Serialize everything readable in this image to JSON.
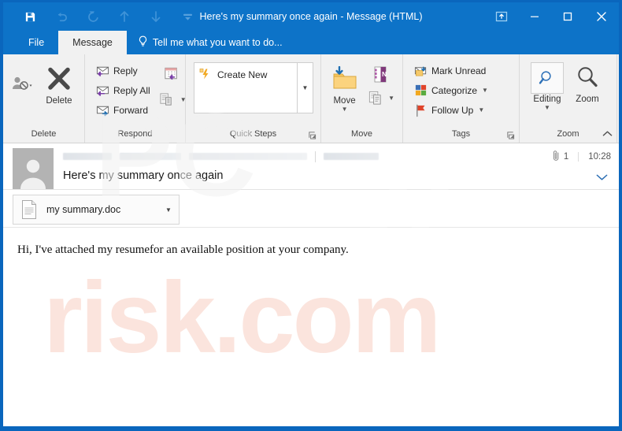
{
  "window": {
    "title": "Here's my summary once again - Message (HTML)",
    "accent_color": "#0d73c8",
    "border_color": "#0a66bd"
  },
  "quick_access_toolbar": {
    "items": [
      {
        "name": "save",
        "icon": "save-icon",
        "enabled": true
      },
      {
        "name": "undo",
        "icon": "undo-icon",
        "enabled": false
      },
      {
        "name": "redo",
        "icon": "redo-icon",
        "enabled": false
      },
      {
        "name": "previous-item",
        "icon": "arrow-up-icon",
        "enabled": false
      },
      {
        "name": "next-item",
        "icon": "arrow-down-icon",
        "enabled": false
      },
      {
        "name": "customize",
        "icon": "chevron-down-icon",
        "enabled": false
      }
    ]
  },
  "window_controls": {
    "restore_ribbon": "restore-window-icon",
    "minimize": "minimize-icon",
    "maximize": "maximize-icon",
    "close": "close-icon"
  },
  "tabs": {
    "file": "File",
    "message": "Message",
    "tell_me": "Tell me what you want to do...",
    "active": "Message"
  },
  "ribbon": {
    "groups": [
      {
        "label": "Delete",
        "buttons": [
          {
            "label": "Ignore",
            "icon": "ignore-person-icon",
            "has_caret": true
          },
          {
            "label": "Delete",
            "icon": "delete-x-icon",
            "has_caret": false
          }
        ]
      },
      {
        "label": "Respond",
        "buttons": [
          {
            "label": "Reply",
            "icon": "reply-icon"
          },
          {
            "label": "Reply All",
            "icon": "reply-all-icon"
          },
          {
            "label": "Forward",
            "icon": "forward-icon"
          },
          {
            "label": "Meeting",
            "icon": "meeting-calendar-icon"
          },
          {
            "label": "More",
            "icon": "more-respond-icon",
            "has_caret": true
          }
        ]
      },
      {
        "label": "Quick Steps",
        "gallery_items": [
          {
            "label": "Create New",
            "icon": "lightning-bolt-icon"
          }
        ],
        "more_caret": true,
        "dialog_launcher": true
      },
      {
        "label": "Move",
        "buttons": [
          {
            "label": "Move",
            "icon": "move-folder-icon",
            "has_caret": true
          },
          {
            "label": "OneNote",
            "icon": "onenote-icon"
          },
          {
            "label": "Rules",
            "icon": "rules-icon",
            "has_caret": true
          }
        ]
      },
      {
        "label": "Tags",
        "buttons": [
          {
            "label": "Mark Unread",
            "icon": "mark-unread-envelope-icon"
          },
          {
            "label": "Categorize",
            "icon": "categorize-swatch-icon",
            "has_caret": true
          },
          {
            "label": "Follow Up",
            "icon": "follow-up-flag-icon",
            "has_caret": true
          }
        ],
        "dialog_launcher": true
      },
      {
        "label": "Zoom",
        "buttons": [
          {
            "label": "Editing",
            "icon": "editing-magnifier-icon",
            "has_caret": true,
            "selected": true
          },
          {
            "label": "Zoom",
            "icon": "zoom-magnifier-icon"
          }
        ]
      }
    ],
    "collapse_icon": "chevron-up-icon"
  },
  "message": {
    "avatar": "default-person-avatar",
    "sender_redacted": true,
    "subject": "Here's my summary once again",
    "attachment_count": "1",
    "attachment_icon": "paperclip-icon",
    "time": "10:28",
    "expand_icon": "chevron-down-icon",
    "attachment": {
      "filename": "my summary.doc",
      "icon": "document-file-icon",
      "caret": "chevron-down-icon"
    },
    "body": "Hi, I've attached my resumefor an available position at your company."
  },
  "watermark": {
    "line1": "PC",
    "line2": "risk.com",
    "color": "#f6c4b4"
  }
}
